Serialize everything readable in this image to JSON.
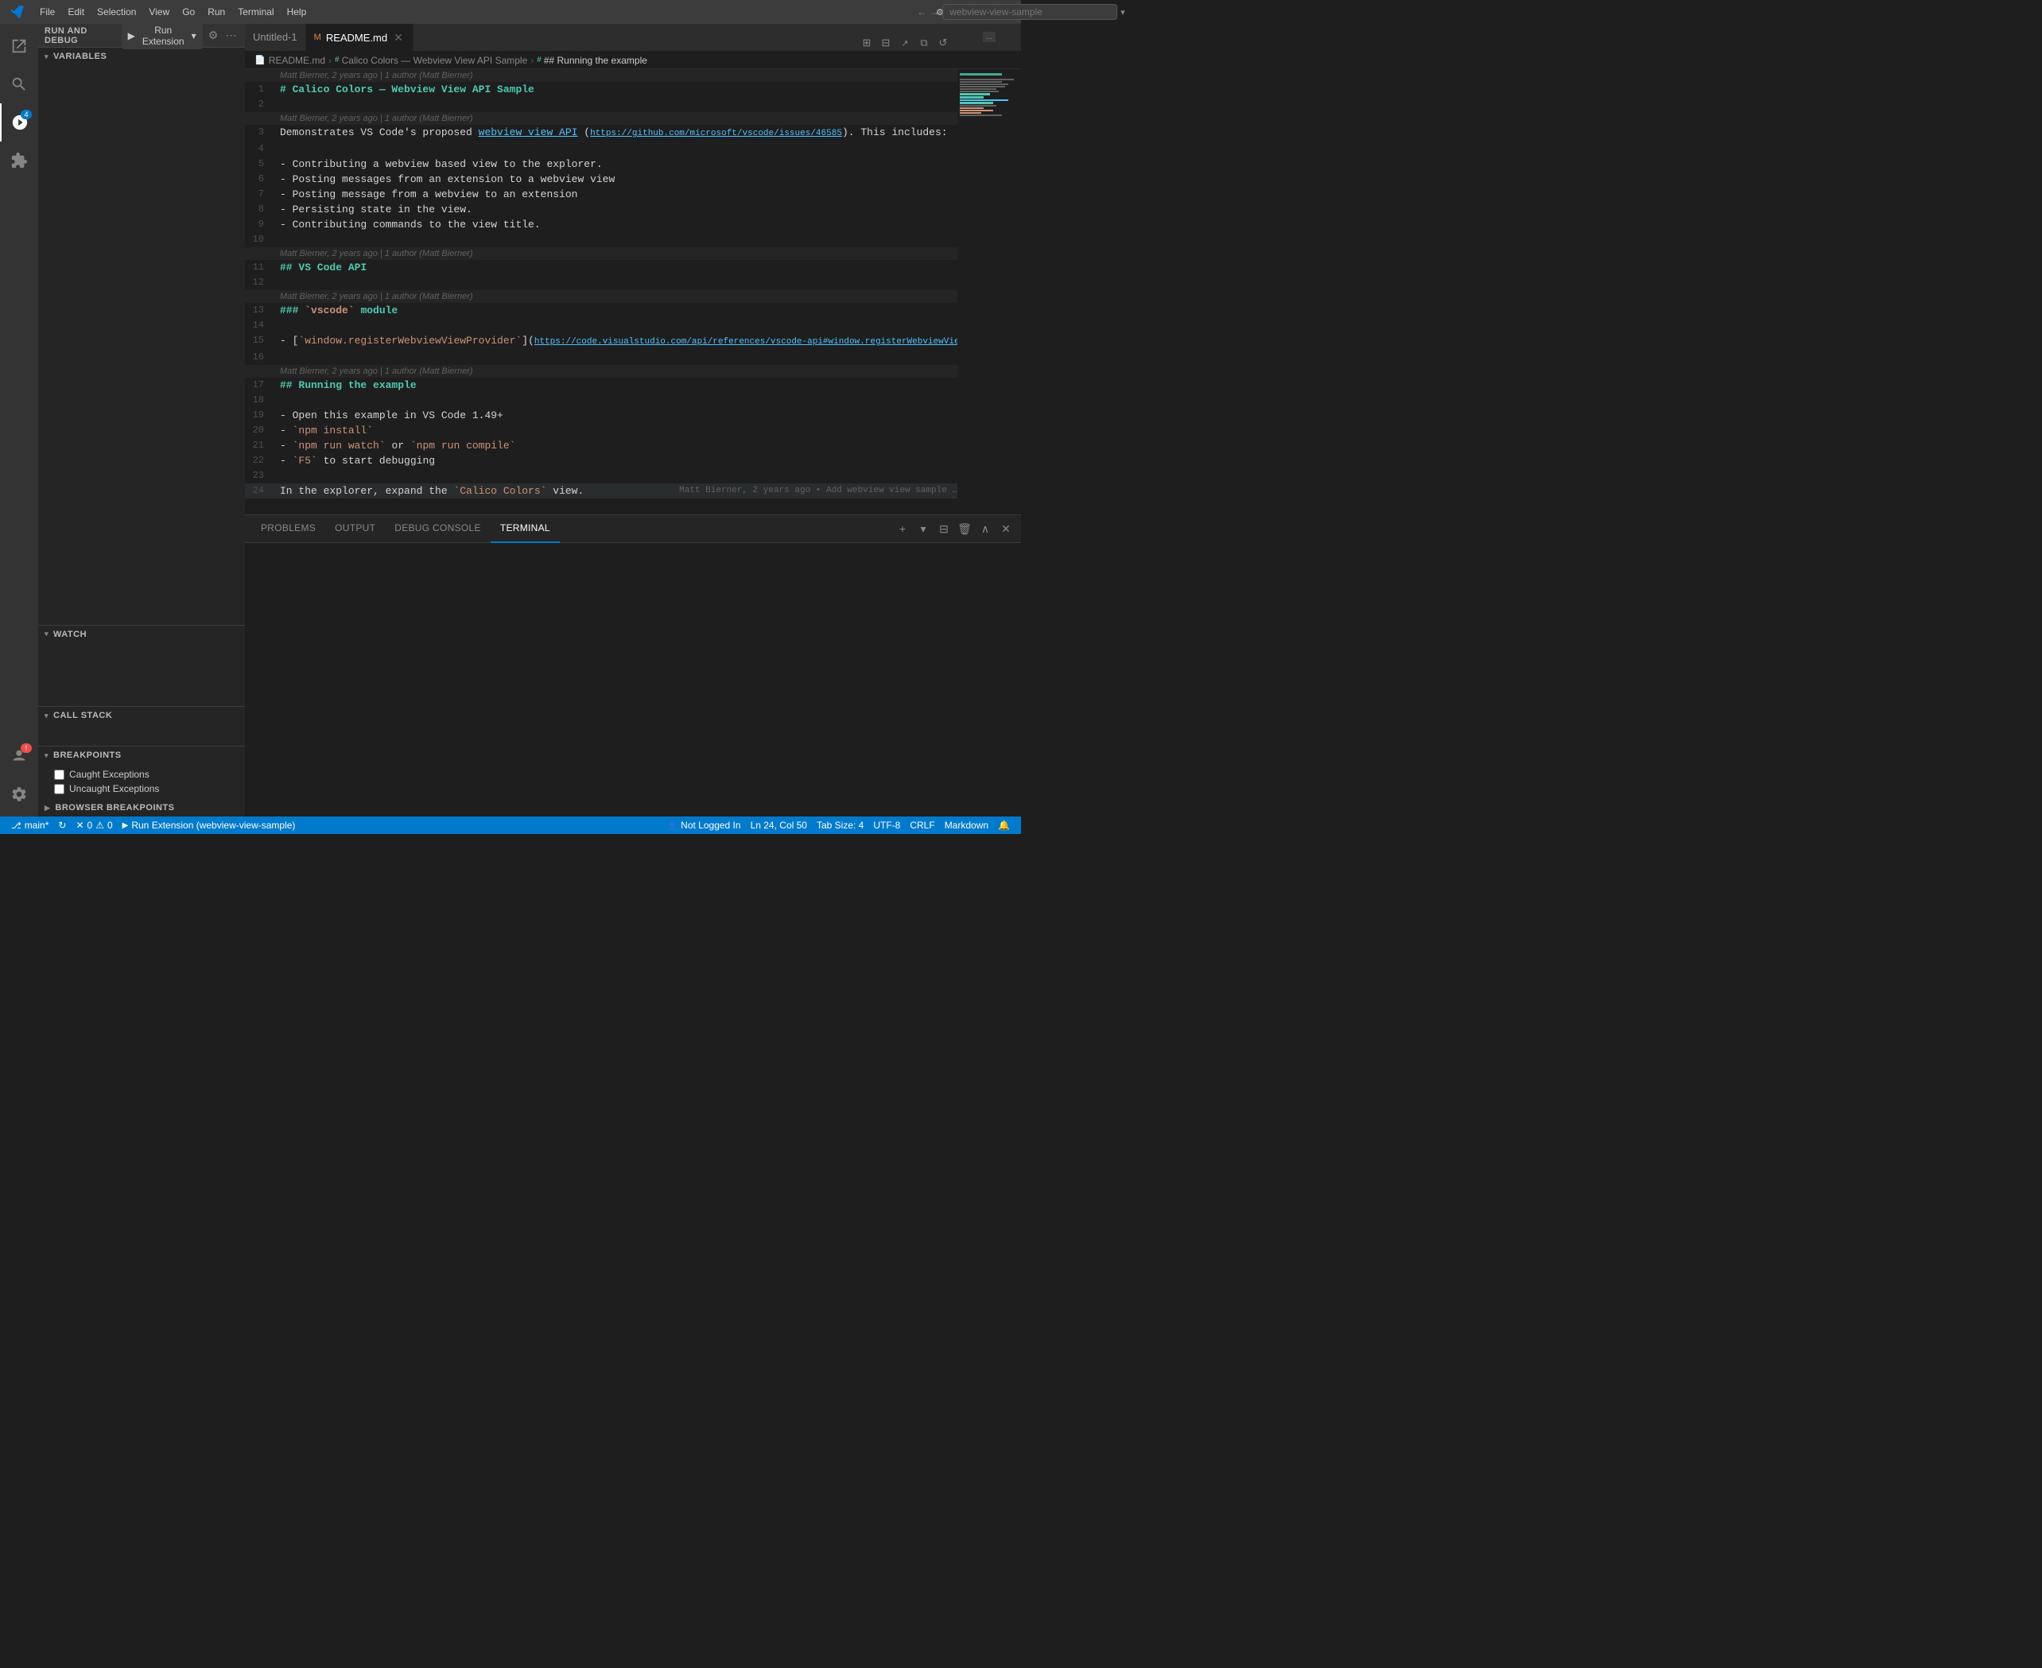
{
  "titlebar": {
    "app_icon": "●",
    "menus": [
      "File",
      "Edit",
      "Selection",
      "View",
      "Go",
      "Run",
      "Terminal",
      "Help"
    ],
    "nav_back": "←",
    "nav_forward": "→",
    "search_placeholder": "webview-view-sample",
    "search_dropdown": "▾",
    "window_buttons": {
      "minimize": "─",
      "maximize": "□",
      "restore": "❐",
      "close": "✕"
    }
  },
  "debug_toolbar": {
    "label": "RUN AND DEBUG",
    "run_btn": "Run Extension",
    "run_icon": "▶",
    "dropdown_icon": "▾",
    "icons": [
      "⋯",
      "↻",
      "⏮",
      "⏭",
      "⏸",
      "⏹",
      "⏏"
    ]
  },
  "tabs": [
    {
      "name": "Untitled-1",
      "active": false,
      "dirty": false
    },
    {
      "name": "README.md",
      "active": true,
      "dirty": false
    }
  ],
  "breadcrumb": {
    "items": [
      {
        "label": "README.md",
        "icon": "📄"
      },
      {
        "label": "Calico Colors — Webview View API Sample"
      },
      {
        "label": "## Running the example",
        "active": true
      }
    ]
  },
  "code_lines": [
    {
      "num": 1,
      "content": "# Calico Colors — Webview View API Sample",
      "type": "h1",
      "blame": ""
    },
    {
      "num": 2,
      "content": "",
      "type": "blank",
      "blame": ""
    },
    {
      "num": 3,
      "content": "Demonstrates VS Code's proposed [webview view API](https://github.com/microsoft/vscode/issues/46585). This includes:",
      "type": "text",
      "blame": ""
    },
    {
      "num": 4,
      "content": "",
      "type": "blank",
      "blame": ""
    },
    {
      "num": 5,
      "content": "- Contributing a webview based view to the explorer.",
      "type": "bullet",
      "blame": ""
    },
    {
      "num": 6,
      "content": "- Posting messages from an extension to a webview view",
      "type": "bullet",
      "blame": ""
    },
    {
      "num": 7,
      "content": "- Posting message from a webview to an extension",
      "type": "bullet",
      "blame": ""
    },
    {
      "num": 8,
      "content": "- Persisting state in the view.",
      "type": "bullet",
      "blame": ""
    },
    {
      "num": 9,
      "content": "- Contributing commands to the view title.",
      "type": "bullet",
      "blame": ""
    },
    {
      "num": 10,
      "content": "",
      "type": "blank",
      "blame": ""
    },
    {
      "num": 11,
      "content": "## VS Code API",
      "type": "h2",
      "blame": ""
    },
    {
      "num": 12,
      "content": "",
      "type": "blank",
      "blame": ""
    },
    {
      "num": 13,
      "content": "### `vscode` module",
      "type": "h3",
      "blame": ""
    },
    {
      "num": 14,
      "content": "",
      "type": "blank",
      "blame": ""
    },
    {
      "num": 15,
      "content": "- [`window.registerWebviewViewProvider`](https://code.visualstudio.com/api/references/vscode-api#window.registerWebviewViewProvider)",
      "type": "bullet",
      "blame": ""
    },
    {
      "num": 16,
      "content": "",
      "type": "blank",
      "blame": ""
    },
    {
      "num": 17,
      "content": "## Running the example",
      "type": "h2",
      "blame": ""
    },
    {
      "num": 18,
      "content": "",
      "type": "blank",
      "blame": ""
    },
    {
      "num": 19,
      "content": "- Open this example in VS Code 1.49+",
      "type": "bullet",
      "blame": ""
    },
    {
      "num": 20,
      "content": "- `npm install`",
      "type": "bullet",
      "blame": ""
    },
    {
      "num": 21,
      "content": "- `npm run watch` or `npm run compile`",
      "type": "bullet",
      "blame": ""
    },
    {
      "num": 22,
      "content": "- `F5` to start debugging",
      "type": "bullet",
      "blame": ""
    },
    {
      "num": 23,
      "content": "",
      "type": "blank",
      "blame": ""
    },
    {
      "num": 24,
      "content": "In the explorer, expand the `Calico Colors` view.",
      "type": "text",
      "blame": "Matt Bierner, 2 years ago • Add webview view sample …"
    }
  ],
  "blame_headers": {
    "line1": "Matt Bierner, 2 years ago | 1 author (Matt Bierner)",
    "line3": "Matt Bierner, 2 years ago | 1 author (Matt Bierner)",
    "line11": "Matt Bierner, 2 years ago | 1 author (Matt Bierner)",
    "line13": "Matt Bierner, 2 years ago | 1 author (Matt Bierner)",
    "line17": "Matt Bierner, 2 years ago | 1 author (Matt Bierner)"
  },
  "sidebar": {
    "run_debug_label": "RUN AND DEBUG",
    "sections": {
      "variables": {
        "label": "VARIABLES",
        "expanded": true
      },
      "watch": {
        "label": "WATCH",
        "expanded": true
      },
      "call_stack": {
        "label": "CALL STACK",
        "expanded": true
      },
      "breakpoints": {
        "label": "BREAKPOINTS",
        "expanded": true
      },
      "browser_breakpoints": {
        "label": "BROWSER BREAKPOINTS",
        "expanded": true
      }
    },
    "breakpoints": [
      {
        "label": "Caught Exceptions",
        "checked": false
      },
      {
        "label": "Uncaught Exceptions",
        "checked": false
      }
    ]
  },
  "panel": {
    "tabs": [
      {
        "label": "PROBLEMS",
        "active": false
      },
      {
        "label": "OUTPUT",
        "active": false
      },
      {
        "label": "DEBUG CONSOLE",
        "active": false
      },
      {
        "label": "TERMINAL",
        "active": true
      }
    ]
  },
  "status_bar": {
    "left_items": [
      {
        "icon": "✕",
        "label": "0",
        "icon2": "⚠",
        "label2": "0"
      },
      {
        "label": "Run Extension (webview-view-sample)"
      }
    ],
    "git": "main*",
    "sync_icon": "↻",
    "errors": "0",
    "warnings": "0",
    "right_items": [
      {
        "label": "Not Logged In"
      },
      {
        "label": "Ln 24, Col 50"
      },
      {
        "label": "Tab Size: 4"
      },
      {
        "label": "UTF-8"
      },
      {
        "label": "CRLF"
      },
      {
        "label": "Markdown"
      }
    ],
    "bell": "🔔",
    "person": "👤"
  },
  "colors": {
    "titlebar_bg": "#3c3c3c",
    "activity_bg": "#333333",
    "sidebar_bg": "#252526",
    "editor_bg": "#1e1e1e",
    "panel_bg": "#252526",
    "status_bg": "#007acc",
    "accent": "#007acc",
    "h1_color": "#4ec9b0",
    "link_color": "#4fc1ff",
    "code_color": "#ce9178"
  }
}
